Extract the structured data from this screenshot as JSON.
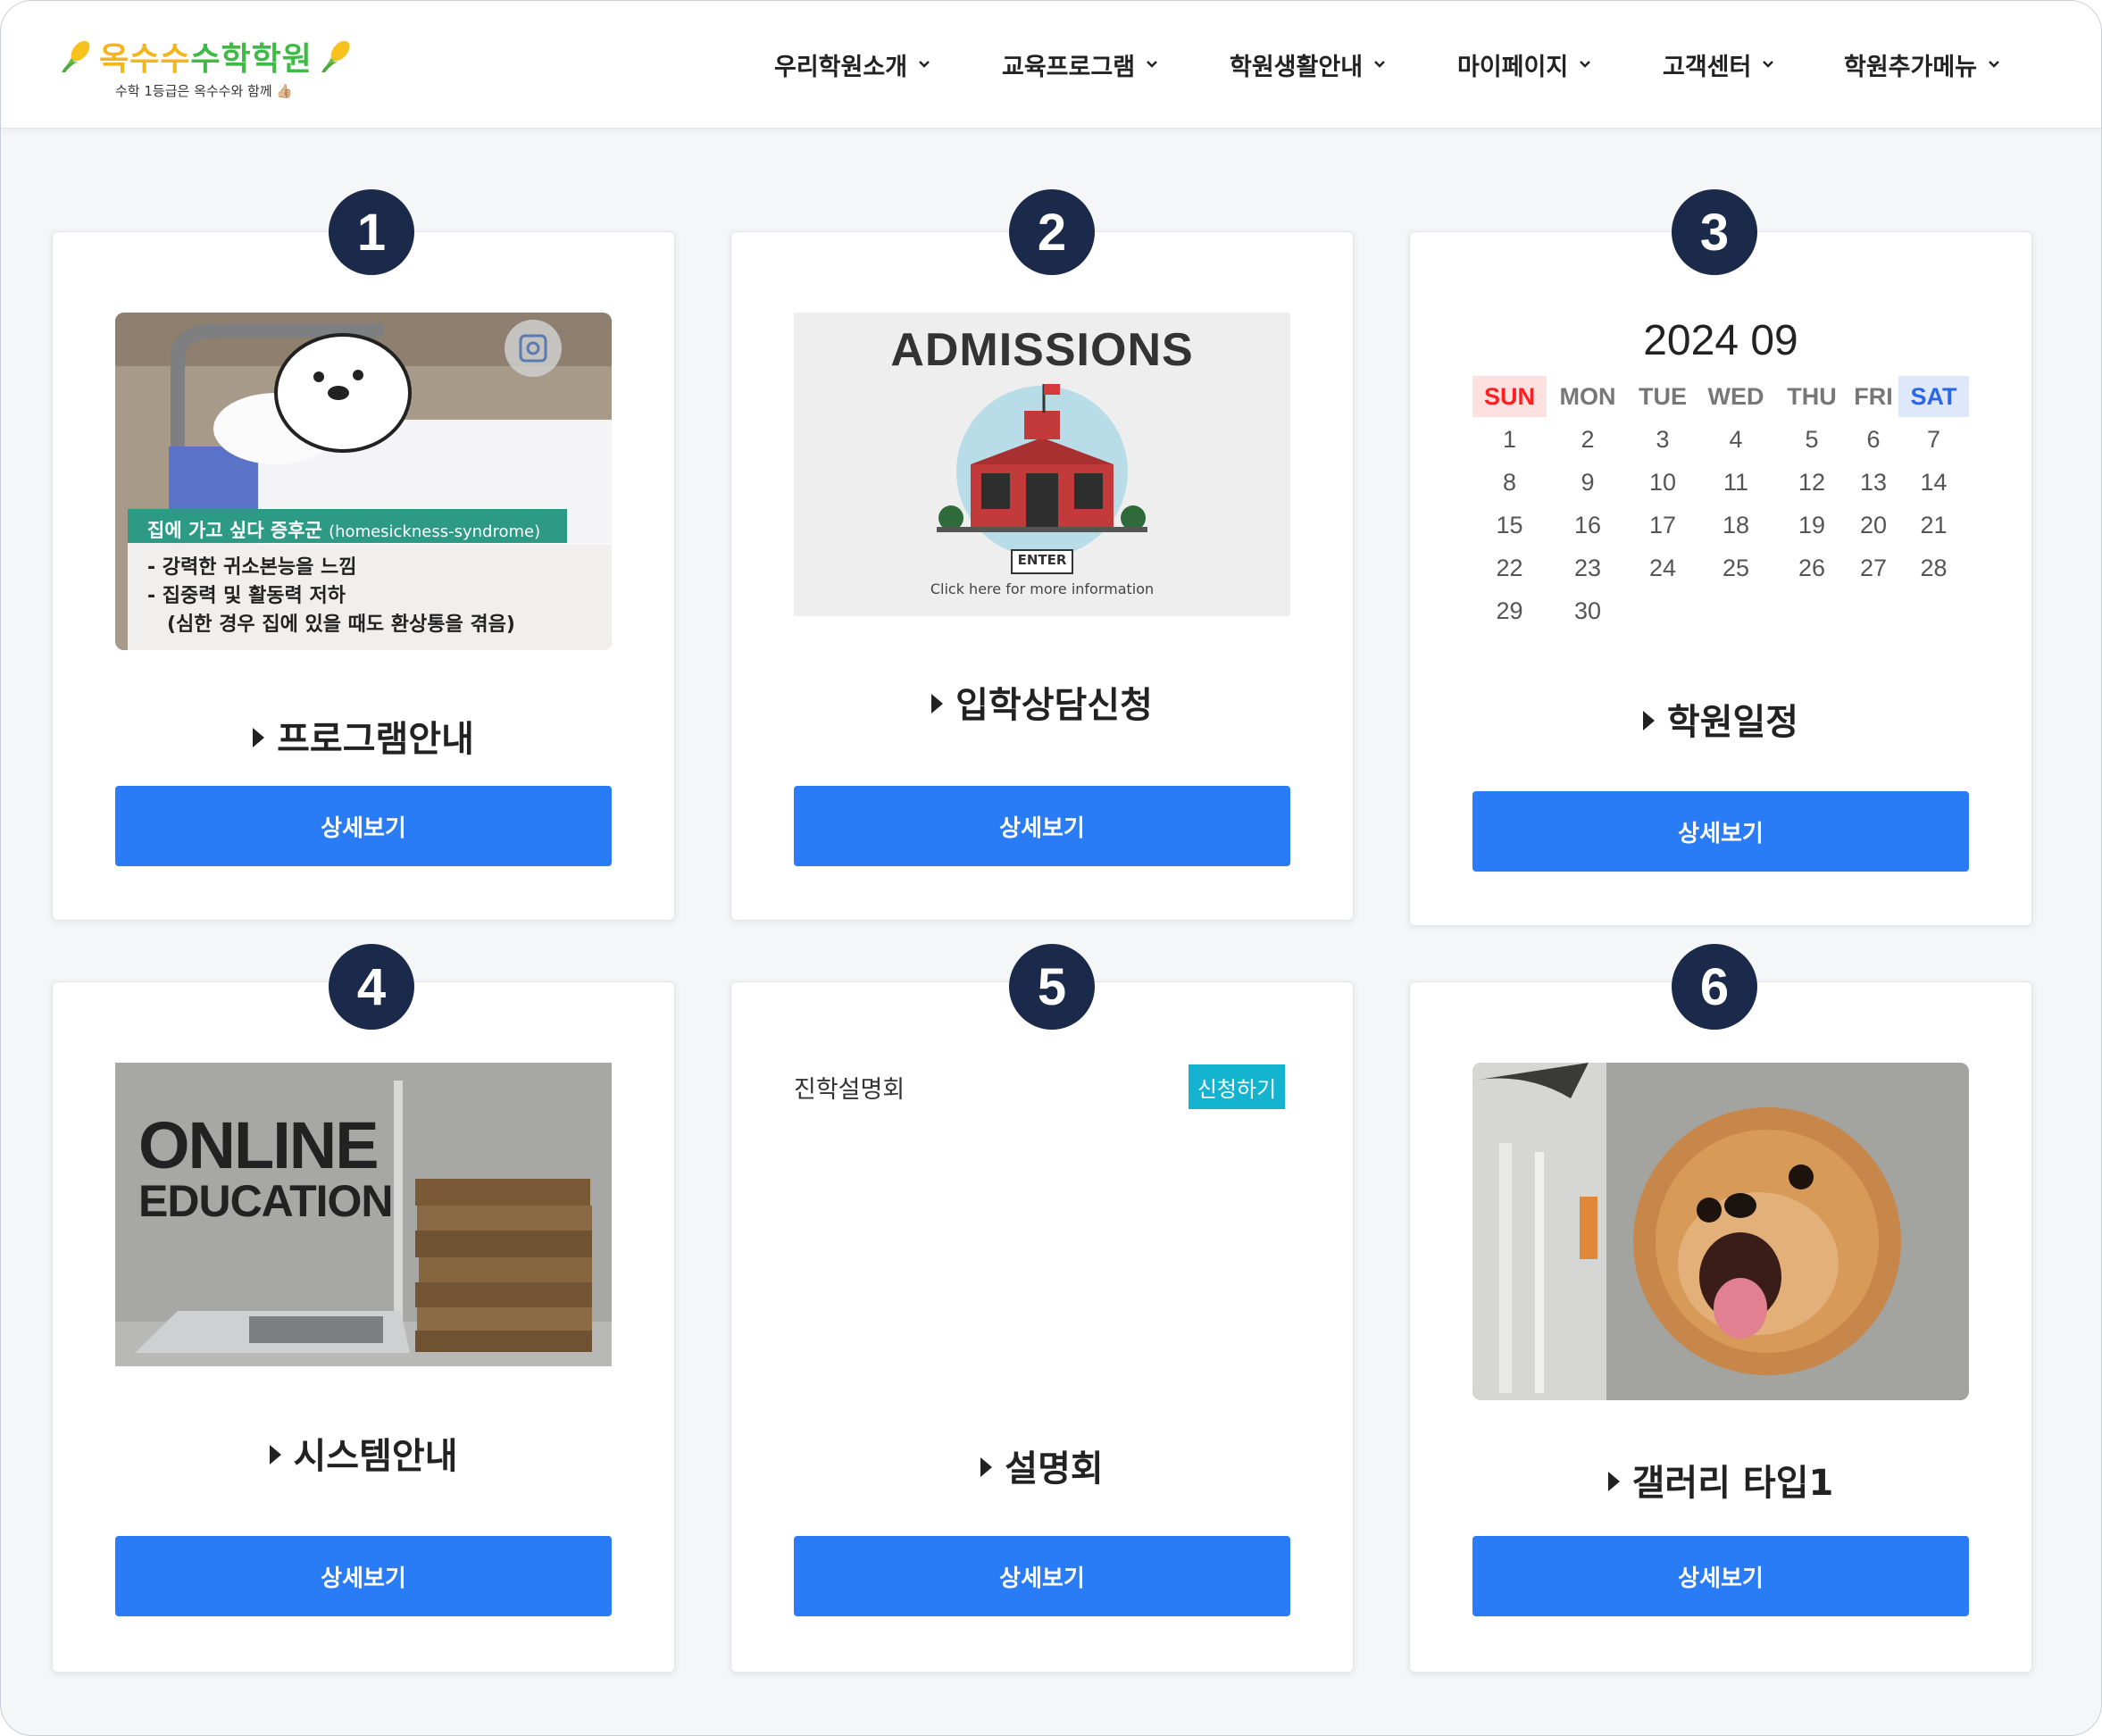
{
  "brand": {
    "name_part1": "옥수수",
    "name_part2": "수학학원",
    "tagline": "수학 1등급은 옥수수와 함께 👍🏼"
  },
  "nav": [
    {
      "label": "우리학원소개"
    },
    {
      "label": "교육프로그램"
    },
    {
      "label": "학원생활안내"
    },
    {
      "label": "마이페이지"
    },
    {
      "label": "고객센터"
    },
    {
      "label": "학원추가메뉴"
    }
  ],
  "cards": [
    {
      "number": "1",
      "title": "프로그램안내",
      "button": "상세보기",
      "image": {
        "caption_title": "집에 가고 싶다 증후군",
        "caption_en": "(homesickness-syndrome)",
        "lines": [
          "- 강력한 귀소본능을 느낌",
          "- 집중력 및 활동력 저하",
          "(심한 경우 집에 있을 때도 환상통을 겪음)"
        ]
      }
    },
    {
      "number": "2",
      "title": "입학상담신청",
      "button": "상세보기",
      "image": {
        "heading": "ADMISSIONS",
        "enter": "ENTER",
        "sub": "Click here for more information"
      }
    },
    {
      "number": "3",
      "title": "학원일정",
      "button": "상세보기",
      "calendar": {
        "title": "2024 09",
        "weekdays": [
          "SUN",
          "MON",
          "TUE",
          "WED",
          "THU",
          "FRI",
          "SAT"
        ],
        "weeks": [
          [
            "1",
            "2",
            "3",
            "4",
            "5",
            "6",
            "7"
          ],
          [
            "8",
            "9",
            "10",
            "11",
            "12",
            "13",
            "14"
          ],
          [
            "15",
            "16",
            "17",
            "18",
            "19",
            "20",
            "21"
          ],
          [
            "22",
            "23",
            "24",
            "25",
            "26",
            "27",
            "28"
          ],
          [
            "29",
            "30",
            "",
            "",
            "",
            "",
            ""
          ]
        ]
      }
    },
    {
      "number": "4",
      "title": "시스템안내",
      "button": "상세보기",
      "image": {
        "line1": "ONLINE",
        "line2": "EDUCATION"
      }
    },
    {
      "number": "5",
      "title": "설명회",
      "button": "상세보기",
      "seminar": {
        "label": "진학설명회",
        "apply": "신청하기"
      }
    },
    {
      "number": "6",
      "title": "갤러리 타입1",
      "button": "상세보기"
    }
  ],
  "colors": {
    "primary_button": "#2a7cf6",
    "badge": "#1b2a4a",
    "apply_button": "#14b3cf",
    "sun": "#ff1f1f",
    "sat": "#2a66e8"
  }
}
